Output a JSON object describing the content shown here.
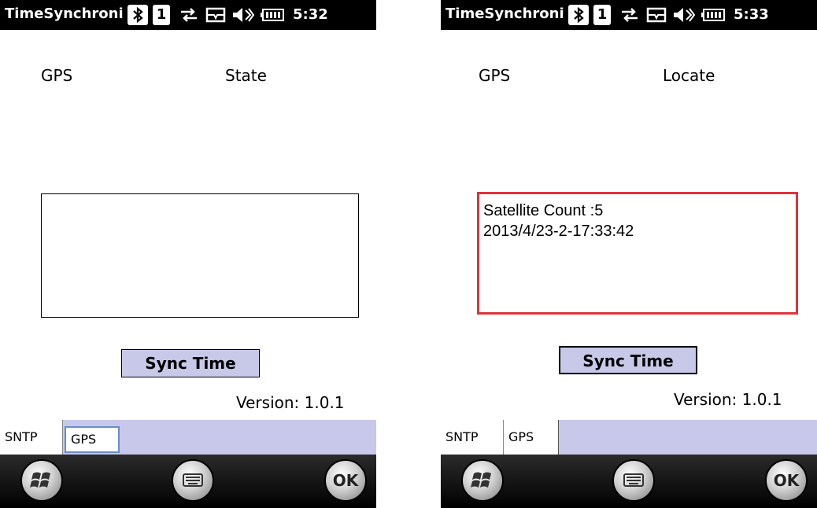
{
  "screens": [
    {
      "title": "TimeSynchronizer",
      "time": "5:32",
      "sim_label": "1",
      "gps_label": "GPS",
      "status_label": "State",
      "info_lines": [],
      "sync_button": "Sync Time",
      "version": "Version: 1.0.1",
      "tabs": [
        "SNTP",
        "GPS"
      ],
      "active_tab": "GPS",
      "ok_label": "OK"
    },
    {
      "title": "TimeSynchronizer",
      "time": "5:33",
      "sim_label": "1",
      "gps_label": "GPS",
      "status_label": "Locate",
      "info_lines": [
        "Satellite Count :5",
        "2013/4/23-2-17:33:42"
      ],
      "sync_button": "Sync Time",
      "version": "Version: 1.0.1",
      "tabs": [
        "SNTP",
        "GPS"
      ],
      "active_tab": "GPS",
      "ok_label": "OK"
    }
  ],
  "status_icons": [
    "bluetooth-icon",
    "sim-icon",
    "data-connection-icon",
    "message-icon",
    "volume-icon",
    "battery-icon"
  ],
  "colors": {
    "titlebar": "#000000",
    "tabstrip": "#c8c8ea",
    "button": "#c8c8e8",
    "highlight_box": "#e0323a"
  }
}
